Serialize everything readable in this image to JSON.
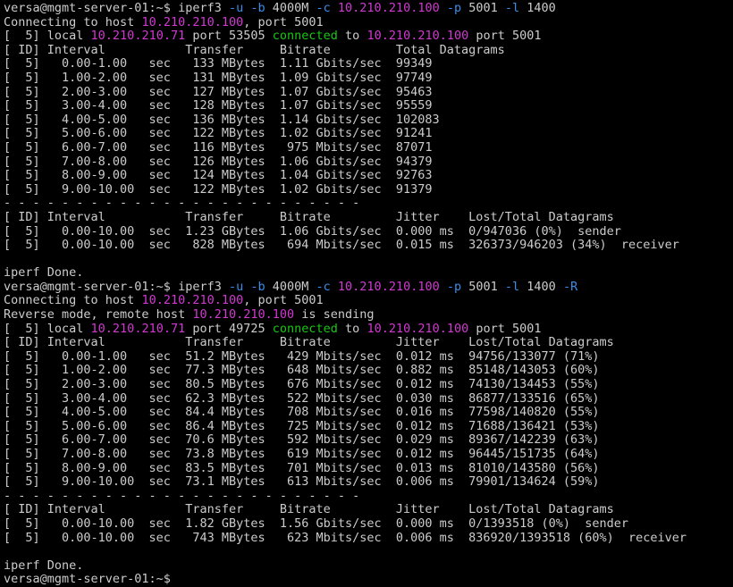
{
  "colors": {
    "background": "#000000",
    "text": "#cccccc",
    "magenta": "#d238d2",
    "green": "#19c619",
    "cyan": "#3b8eea",
    "dash": "#cccccc"
  },
  "terminal": {
    "lines": [
      [
        {
          "t": "versa@mgmt-server-01:~$ iperf3 ",
          "c": "text"
        },
        {
          "t": "-u -b",
          "c": "cyan"
        },
        {
          "t": " 4000M ",
          "c": "text"
        },
        {
          "t": "-c",
          "c": "cyan"
        },
        {
          "t": " ",
          "c": "text"
        },
        {
          "t": "10.210.210.100",
          "c": "magenta"
        },
        {
          "t": " ",
          "c": "text"
        },
        {
          "t": "-p",
          "c": "cyan"
        },
        {
          "t": " 5001 ",
          "c": "text"
        },
        {
          "t": "-l",
          "c": "cyan"
        },
        {
          "t": " 1400",
          "c": "text"
        }
      ],
      [
        {
          "t": "Connecting to host ",
          "c": "text"
        },
        {
          "t": "10.210.210.100",
          "c": "magenta"
        },
        {
          "t": ", port 5001",
          "c": "text"
        }
      ],
      [
        {
          "t": "[  5] local ",
          "c": "text"
        },
        {
          "t": "10.210.210.71",
          "c": "magenta"
        },
        {
          "t": " port 53505 ",
          "c": "text"
        },
        {
          "t": "connected",
          "c": "green"
        },
        {
          "t": " to ",
          "c": "text"
        },
        {
          "t": "10.210.210.100",
          "c": "magenta"
        },
        {
          "t": " port 5001",
          "c": "text"
        }
      ],
      [
        {
          "t": "[ ID] Interval           Transfer     Bitrate         Total Datagrams",
          "c": "text"
        }
      ],
      [
        {
          "t": "[  5]   0.00-1.00   sec   133 MBytes  1.11 Gbits/sec  99349",
          "c": "text"
        }
      ],
      [
        {
          "t": "[  5]   1.00-2.00   sec   131 MBytes  1.09 Gbits/sec  97749",
          "c": "text"
        }
      ],
      [
        {
          "t": "[  5]   2.00-3.00   sec   127 MBytes  1.07 Gbits/sec  95463",
          "c": "text"
        }
      ],
      [
        {
          "t": "[  5]   3.00-4.00   sec   128 MBytes  1.07 Gbits/sec  95559",
          "c": "text"
        }
      ],
      [
        {
          "t": "[  5]   4.00-5.00   sec   136 MBytes  1.14 Gbits/sec  102083",
          "c": "text"
        }
      ],
      [
        {
          "t": "[  5]   5.00-6.00   sec   122 MBytes  1.02 Gbits/sec  91241",
          "c": "text"
        }
      ],
      [
        {
          "t": "[  5]   6.00-7.00   sec   116 MBytes   975 Mbits/sec  87071",
          "c": "text"
        }
      ],
      [
        {
          "t": "[  5]   7.00-8.00   sec   126 MBytes  1.06 Gbits/sec  94379",
          "c": "text"
        }
      ],
      [
        {
          "t": "[  5]   8.00-9.00   sec   124 MBytes  1.04 Gbits/sec  92763",
          "c": "text"
        }
      ],
      [
        {
          "t": "[  5]   9.00-10.00  sec   122 MBytes  1.02 Gbits/sec  91379",
          "c": "text"
        }
      ],
      [
        {
          "t": "- - - - - - - - - - - - - - - - - - - - - - - - -",
          "c": "text"
        }
      ],
      [
        {
          "t": "[ ID] Interval           Transfer     Bitrate         Jitter    Lost/Total Datagrams",
          "c": "text"
        }
      ],
      [
        {
          "t": "[  5]   0.00-10.00  sec  1.23 GBytes  1.06 Gbits/sec  0.000 ms  0/947036 (0%)  sender",
          "c": "text"
        }
      ],
      [
        {
          "t": "[  5]   0.00-10.00  sec   828 MBytes   694 Mbits/sec  0.015 ms  326373/946203 (34%)  receiver",
          "c": "text"
        }
      ],
      [
        {
          "t": "",
          "c": "text"
        }
      ],
      [
        {
          "t": "iperf Done.",
          "c": "text"
        }
      ],
      [
        {
          "t": "versa@mgmt-server-01:~$ iperf3 ",
          "c": "text"
        },
        {
          "t": "-u -b",
          "c": "cyan"
        },
        {
          "t": " 4000M ",
          "c": "text"
        },
        {
          "t": "-c",
          "c": "cyan"
        },
        {
          "t": " ",
          "c": "text"
        },
        {
          "t": "10.210.210.100",
          "c": "magenta"
        },
        {
          "t": " ",
          "c": "text"
        },
        {
          "t": "-p",
          "c": "cyan"
        },
        {
          "t": " 5001 ",
          "c": "text"
        },
        {
          "t": "-l",
          "c": "cyan"
        },
        {
          "t": " 1400 ",
          "c": "text"
        },
        {
          "t": "-R",
          "c": "cyan"
        }
      ],
      [
        {
          "t": "Connecting to host ",
          "c": "text"
        },
        {
          "t": "10.210.210.100",
          "c": "magenta"
        },
        {
          "t": ", port 5001",
          "c": "text"
        }
      ],
      [
        {
          "t": "Reverse mode, remote host ",
          "c": "text"
        },
        {
          "t": "10.210.210.100",
          "c": "magenta"
        },
        {
          "t": " is sending",
          "c": "text"
        }
      ],
      [
        {
          "t": "[  5] local ",
          "c": "text"
        },
        {
          "t": "10.210.210.71",
          "c": "magenta"
        },
        {
          "t": " port 49725 ",
          "c": "text"
        },
        {
          "t": "connected",
          "c": "green"
        },
        {
          "t": " to ",
          "c": "text"
        },
        {
          "t": "10.210.210.100",
          "c": "magenta"
        },
        {
          "t": " port 5001",
          "c": "text"
        }
      ],
      [
        {
          "t": "[ ID] Interval           Transfer     Bitrate         Jitter    Lost/Total Datagrams",
          "c": "text"
        }
      ],
      [
        {
          "t": "[  5]   0.00-1.00   sec  51.2 MBytes   429 Mbits/sec  0.012 ms  94756/133077 (71%)",
          "c": "text"
        }
      ],
      [
        {
          "t": "[  5]   1.00-2.00   sec  77.3 MBytes   648 Mbits/sec  0.882 ms  85148/143053 (60%)",
          "c": "text"
        }
      ],
      [
        {
          "t": "[  5]   2.00-3.00   sec  80.5 MBytes   676 Mbits/sec  0.012 ms  74130/134453 (55%)",
          "c": "text"
        }
      ],
      [
        {
          "t": "[  5]   3.00-4.00   sec  62.3 MBytes   522 Mbits/sec  0.030 ms  86877/133516 (65%)",
          "c": "text"
        }
      ],
      [
        {
          "t": "[  5]   4.00-5.00   sec  84.4 MBytes   708 Mbits/sec  0.016 ms  77598/140820 (55%)",
          "c": "text"
        }
      ],
      [
        {
          "t": "[  5]   5.00-6.00   sec  86.4 MBytes   725 Mbits/sec  0.012 ms  71688/136421 (53%)",
          "c": "text"
        }
      ],
      [
        {
          "t": "[  5]   6.00-7.00   sec  70.6 MBytes   592 Mbits/sec  0.029 ms  89367/142239 (63%)",
          "c": "text"
        }
      ],
      [
        {
          "t": "[  5]   7.00-8.00   sec  73.8 MBytes   619 Mbits/sec  0.012 ms  96445/151735 (64%)",
          "c": "text"
        }
      ],
      [
        {
          "t": "[  5]   8.00-9.00   sec  83.5 MBytes   701 Mbits/sec  0.013 ms  81010/143580 (56%)",
          "c": "text"
        }
      ],
      [
        {
          "t": "[  5]   9.00-10.00  sec  73.1 MBytes   613 Mbits/sec  0.006 ms  79901/134624 (59%)",
          "c": "text"
        }
      ],
      [
        {
          "t": "- - - - - - - - - - - - - - - - - - - - - - - - -",
          "c": "text"
        }
      ],
      [
        {
          "t": "[ ID] Interval           Transfer     Bitrate         Jitter    Lost/Total Datagrams",
          "c": "text"
        }
      ],
      [
        {
          "t": "[  5]   0.00-10.00  sec  1.82 GBytes  1.56 Gbits/sec  0.000 ms  0/1393518 (0%)  sender",
          "c": "text"
        }
      ],
      [
        {
          "t": "[  5]   0.00-10.00  sec   743 MBytes   623 Mbits/sec  0.006 ms  836920/1393518 (60%)  receiver",
          "c": "text"
        }
      ],
      [
        {
          "t": "",
          "c": "text"
        }
      ],
      [
        {
          "t": "iperf Done.",
          "c": "text"
        }
      ],
      [
        {
          "t": "versa@mgmt-server-01:~$ ",
          "c": "text"
        }
      ]
    ]
  }
}
